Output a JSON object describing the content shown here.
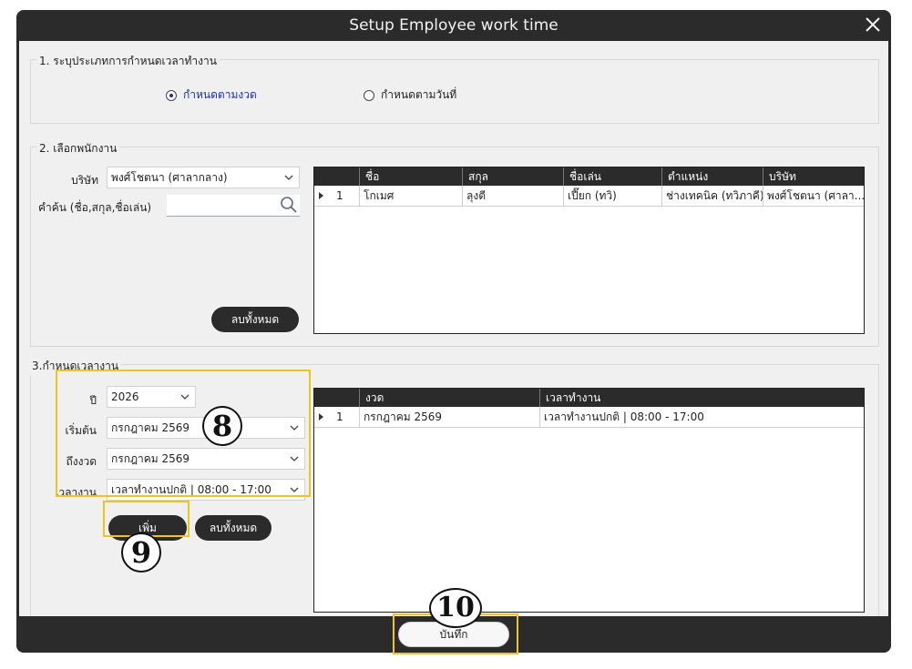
{
  "window": {
    "title": "Setup Employee work time"
  },
  "section1": {
    "legend": "1. ระบุประเภทการกำหนดเวลาทำงาน",
    "options": [
      {
        "label": "กำหนดตามงวด",
        "selected": true
      },
      {
        "label": "กำหนดตามวันที่",
        "selected": false
      }
    ]
  },
  "section2": {
    "legend": "2. เลือกพนักงาน",
    "company_label": "บริษัท",
    "company_value": "พงศ์โชตนา (ศาลากลาง)",
    "search_label": "คำค้น (ชื่อ,สกุล,ชื่อเล่น)",
    "search_value": "",
    "clear_button": "ลบทั้งหมด",
    "grid": {
      "columns": [
        "ชื่อ",
        "สกุล",
        "ชื่อเล่น",
        "ตำแหน่ง",
        "บริษัท"
      ],
      "rows": [
        {
          "no": "1",
          "name": "โกเมศ",
          "surname": "ลุงตี",
          "nickname": "เปี๊ยก (ทวิ)",
          "position": "ช่างเทคนิค (ทวิภาคี)",
          "company": "พงศ์โชตนา (ศาลา..."
        }
      ]
    }
  },
  "section3": {
    "legend": "3.กำหนดเวลางาน",
    "year_label": "ปี",
    "year_value": "2026",
    "start_label": "เริ่มต้น",
    "start_value": "กรกฎาคม 2569",
    "end_label": "ถึงงวด",
    "end_value": "กรกฎาคม 2569",
    "worktime_label": "เวลางาน",
    "worktime_value": "เวลาทำงานปกติ | 08:00 - 17:00",
    "add_button": "เพิ่ม",
    "clear_button": "ลบทั้งหมด",
    "grid": {
      "columns": [
        "งวด",
        "เวลาทำงาน"
      ],
      "rows": [
        {
          "no": "1",
          "period": "กรกฎาคม 2569",
          "worktime": "เวลาทำงานปกติ | 08:00 - 17:00"
        }
      ]
    }
  },
  "footer": {
    "save_button": "บันทึก"
  },
  "callouts": {
    "c8": "8",
    "c9": "9",
    "c10": "10"
  },
  "colors": {
    "highlight": "#f2c31b",
    "dark": "#2b2b2b",
    "selected_radio": "#1a2bd0"
  }
}
